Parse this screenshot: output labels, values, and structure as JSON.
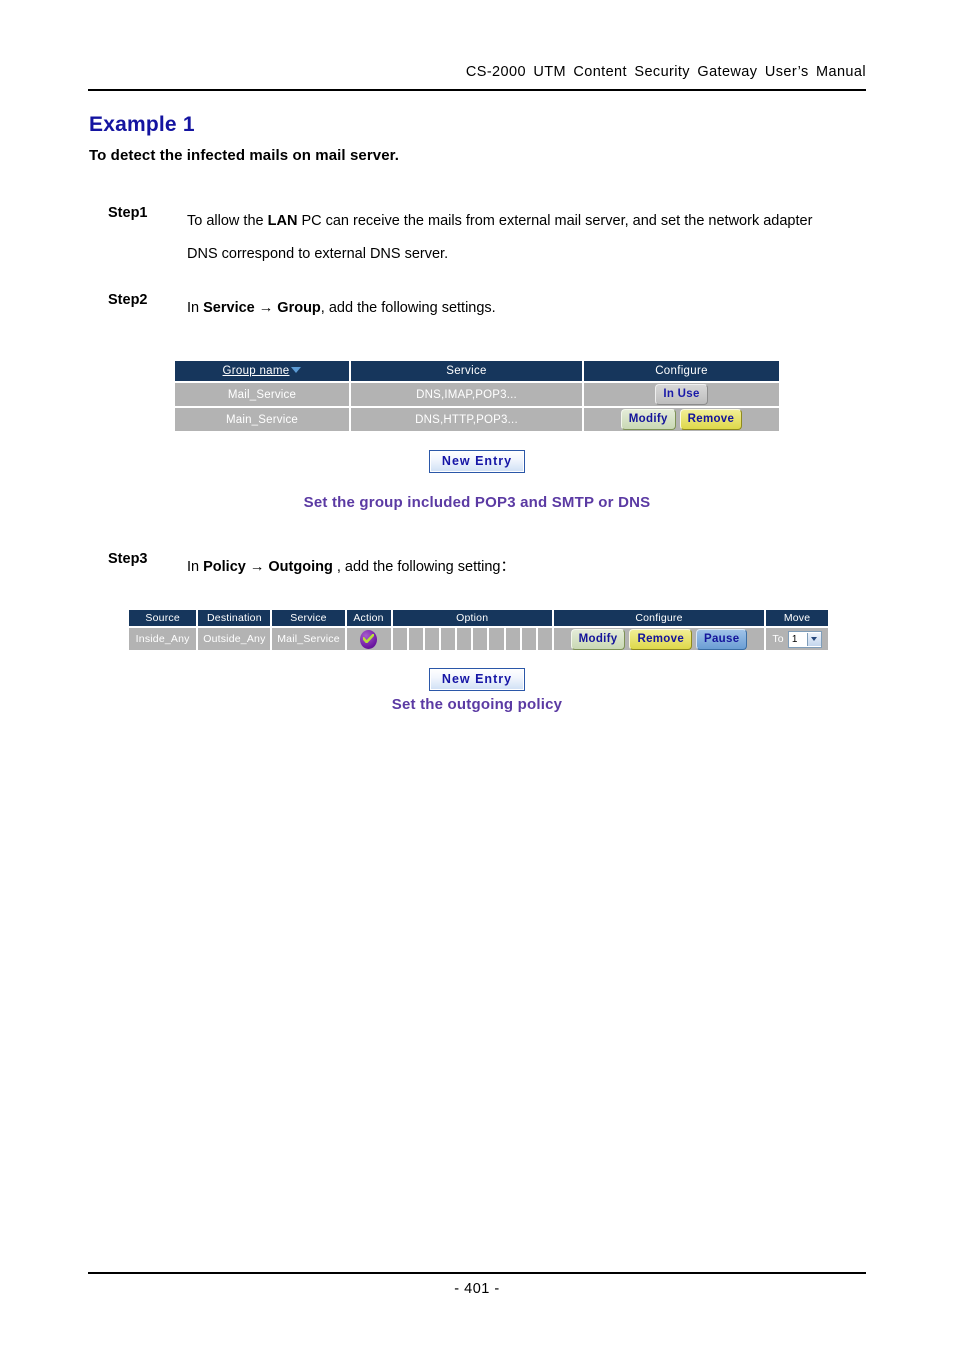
{
  "document": {
    "running_header": "CS-2000  UTM  Content  Security  Gateway  User’s  Manual",
    "page_number": "- 401 -"
  },
  "section": {
    "title": "Example 1",
    "subtitle": "To detect the infected mails on mail server."
  },
  "steps": [
    {
      "label": "Step1",
      "line1_pre": "To allow the ",
      "line1_bold": "LAN",
      "line1_post": " PC can receive the mails from external mail server, and set the network",
      "line2": "adapter DNS correspond to external DNS server."
    },
    {
      "label": "Step2",
      "pre": "In ",
      "bold1": "Service",
      "arrow": "→",
      "bold2": "Group",
      "post": ", add the following settings."
    },
    {
      "label": "Step3",
      "pre": "In ",
      "bold1": "Policy",
      "arrow": "→",
      "bold2": "Outgoing",
      "post": " , add the following setting："
    }
  ],
  "service_group_table": {
    "headers": {
      "group_name": "Group name",
      "service": "Service",
      "configure": "Configure"
    },
    "rows": [
      {
        "group_name": "Mail_Service",
        "service": "DNS,IMAP,POP3...",
        "buttons": [
          "In Use"
        ]
      },
      {
        "group_name": "Main_Service",
        "service": "DNS,HTTP,POP3...",
        "buttons": [
          "Modify",
          "Remove"
        ]
      }
    ],
    "new_entry_label": "New Entry",
    "caption": "Set the group included POP3 and SMTP or DNS"
  },
  "policy_table": {
    "headers": {
      "source": "Source",
      "destination": "Destination",
      "service": "Service",
      "action": "Action",
      "option": "Option",
      "configure": "Configure",
      "move": "Move"
    },
    "row": {
      "source": "Inside_Any",
      "destination": "Outside_Any",
      "service": "Mail_Service",
      "action_icon": "permit-check-icon",
      "option_cell_count": 10,
      "buttons": [
        "Modify",
        "Remove",
        "Pause"
      ],
      "move_to_label": "To",
      "move_value": "1"
    },
    "new_entry_label": "New Entry",
    "caption": "Set the outgoing policy"
  },
  "colors": {
    "table_header_bg": "#16365c",
    "table_row_bg": "#b3b3b3",
    "title_blue": "#1414a0",
    "caption_purple": "#5b3aa3",
    "source_pink": "#ef4c8a",
    "dest_blue": "#1414dd",
    "button_text_blue": "#14149b",
    "remove_yellow": "#ded84a",
    "pause_blue": "#6b9ed4"
  }
}
